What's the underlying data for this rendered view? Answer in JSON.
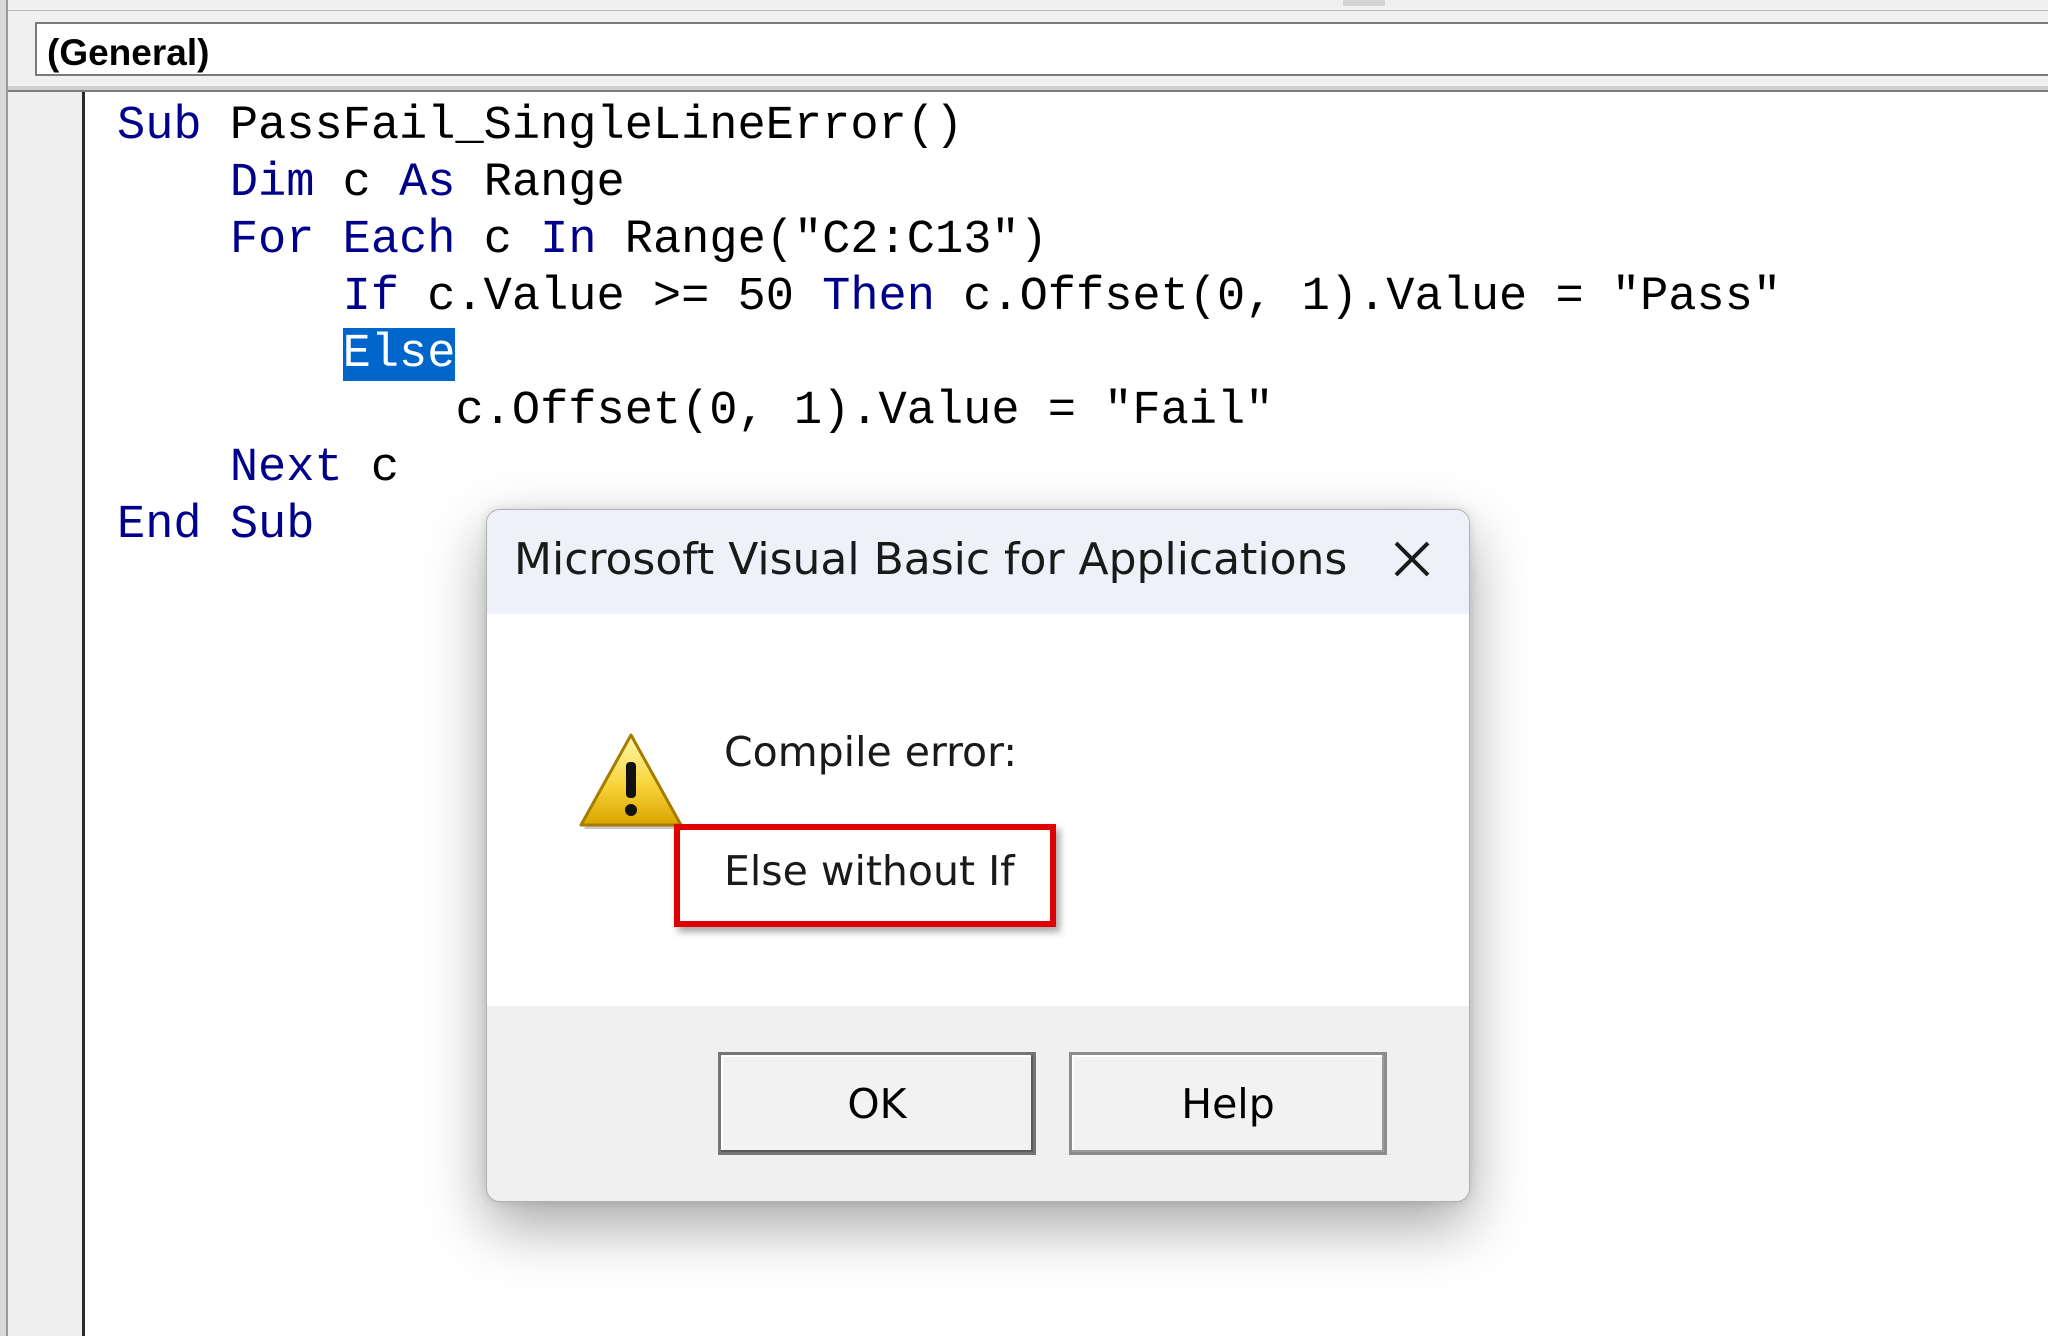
{
  "header": {
    "object_combo_value": "(General)"
  },
  "code": {
    "line1": {
      "kw_sub": "Sub",
      "name": " PassFail_SingleLineError()"
    },
    "line2": {
      "indent": "    ",
      "kw_dim": "Dim",
      "var": " c ",
      "kw_as": "As",
      "type": " Range"
    },
    "line3": {
      "indent": "    ",
      "kw_for": "For",
      "sp1": " ",
      "kw_each": "Each",
      "var": " c ",
      "kw_in": "In",
      "rest": " Range(\"C2:C13\")"
    },
    "line4": {
      "indent": "        ",
      "kw_if": "If",
      "cond": " c.Value >= 50 ",
      "kw_then": "Then",
      "rest": " c.Offset(0, 1).Value = \"Pass\""
    },
    "line5": {
      "indent": "        ",
      "selected_else": "Else"
    },
    "line6": {
      "indent": "            ",
      "stmt": "c.Offset(0, 1).Value = \"Fail\""
    },
    "line7": {
      "indent": "    ",
      "kw_next": "Next",
      "var": " c"
    },
    "line8": {
      "kw_end": "End",
      "sp": " ",
      "kw_sub": "Sub"
    }
  },
  "dialog": {
    "title": "Microsoft Visual Basic for Applications",
    "close_glyph": "close-icon",
    "message_heading": "Compile error:",
    "message_detail": "Else without If",
    "ok_label": "OK",
    "help_label": "Help",
    "highlight_color": "#e10000"
  },
  "colors": {
    "keyword": "#00008b",
    "selection": "#0066cc"
  }
}
